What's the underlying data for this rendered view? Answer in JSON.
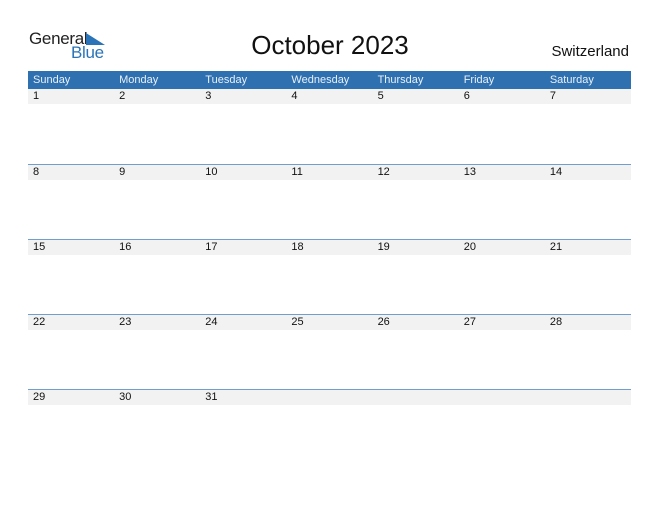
{
  "logo": {
    "line1": "General",
    "line2": "Blue"
  },
  "title": "October 2023",
  "country": "Switzerland",
  "colors": {
    "header_bg": "#2e70b0",
    "accent": "#2a74b7",
    "row_bg": "#f2f2f2"
  },
  "weekdays": [
    "Sunday",
    "Monday",
    "Tuesday",
    "Wednesday",
    "Thursday",
    "Friday",
    "Saturday"
  ],
  "weeks": [
    [
      "1",
      "2",
      "3",
      "4",
      "5",
      "6",
      "7"
    ],
    [
      "8",
      "9",
      "10",
      "11",
      "12",
      "13",
      "14"
    ],
    [
      "15",
      "16",
      "17",
      "18",
      "19",
      "20",
      "21"
    ],
    [
      "22",
      "23",
      "24",
      "25",
      "26",
      "27",
      "28"
    ],
    [
      "29",
      "30",
      "31",
      "",
      "",
      "",
      ""
    ]
  ]
}
